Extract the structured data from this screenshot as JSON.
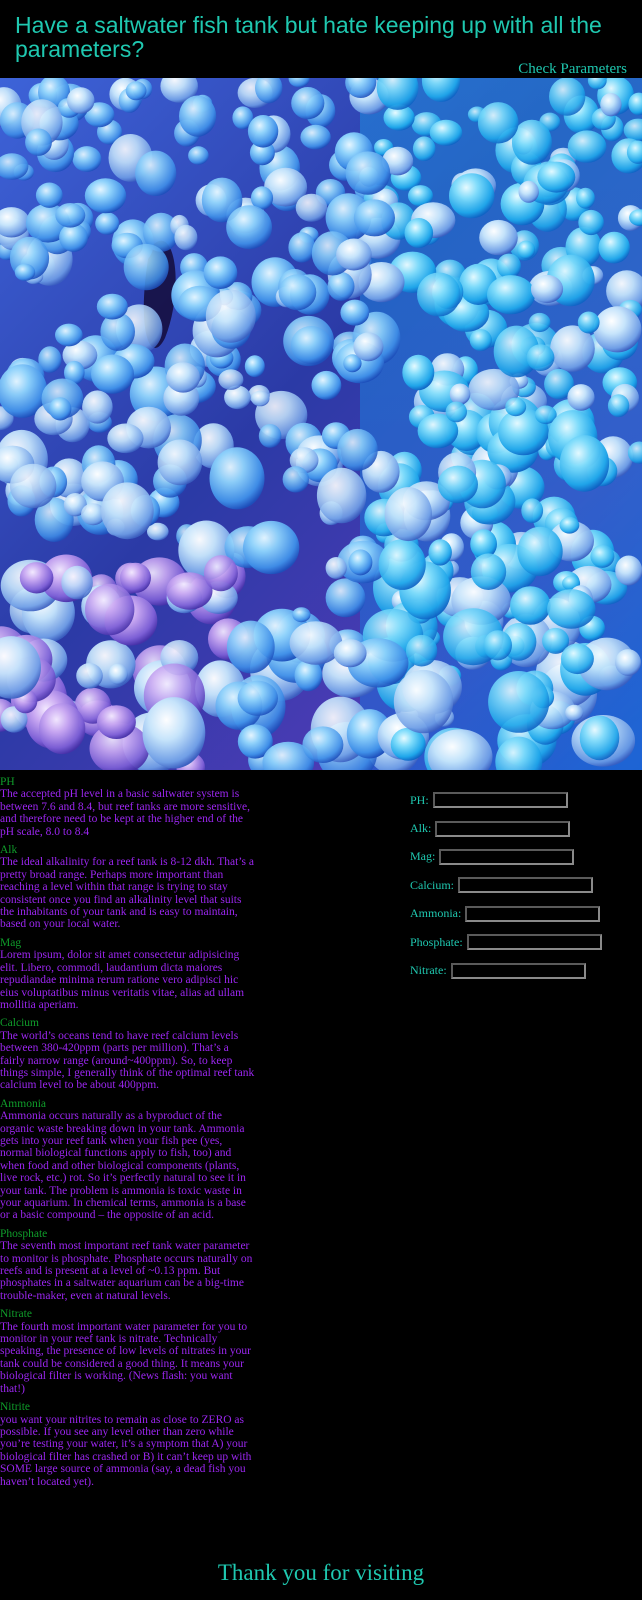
{
  "header": {
    "headline": "Have a saltwater fish tank but hate keeping up with all the parameters?",
    "check_link": "Check Parameters"
  },
  "hero": {
    "image": "bubble-coral-photo",
    "colors": {
      "deep": "#1a1f86",
      "mid": "#3c7fe6",
      "light": "#7fd0fb",
      "pink": "#c287e6"
    }
  },
  "parameters": [
    {
      "title": "PH",
      "text": "The accepted pH level in a basic saltwater system is between 7.6 and 8.4, but reef tanks are more sensitive, and therefore need to be kept at the higher end of the pH scale, 8.0 to 8.4"
    },
    {
      "title": "Alk",
      "text": "The ideal alkalinity for a reef tank is 8-12 dkh. That’s a pretty broad range. Perhaps more important than reaching a level within that range is trying to stay consistent once you find an alkalinity level that suits the inhabitants of your tank and is easy to maintain, based on your local water."
    },
    {
      "title": "Mag",
      "text": "Lorem ipsum, dolor sit amet consectetur adipisicing elit. Libero, commodi, laudantium dicta maiores repudiandae minima rerum ratione vero adipisci hic eius voluptatibus minus veritatis vitae, alias ad ullam mollitia aperiam."
    },
    {
      "title": "Calcium",
      "text": "The world’s oceans tend to have reef calcium levels between 380-420ppm (parts per million). That’s a fairly narrow range (around~400ppm). So, to keep things simple, I generally think of the optimal reef tank calcium level to be about 400ppm."
    },
    {
      "title": "Ammonia",
      "text": "Ammonia occurs naturally as a byproduct of the organic waste breaking down in your tank. Ammonia gets into your reef tank when your fish pee (yes, normal biological functions apply to fish, too) and when food and other biological components (plants, live rock, etc.) rot. So it’s perfectly natural to see it in your tank. The problem is ammonia is toxic waste in your aquarium. In chemical terms, ammonia is a base or a basic compound – the opposite of an acid."
    },
    {
      "title": "Phosphate",
      "text": "The seventh most important reef tank water parameter to monitor is phosphate. Phosphate occurs naturally on reefs and is present at a level of ~0.13 ppm. But phosphates in a saltwater aquarium can be a big-time trouble-maker, even at natural levels."
    },
    {
      "title": "Nitrate",
      "text": "The fourth most important water parameter for you to monitor in your reef tank is nitrate. Technically speaking, the presence of low levels of nitrates in your tank could be considered a good thing. It means your biological filter is working. (News flash: you want that!)"
    },
    {
      "title": "Nitrite",
      "text": "you want your nitrites to remain as close to ZERO as possible. If you see any level other than zero while you’re testing your water, it’s a symptom that A) your biological filter has crashed or B) it can’t keep up with SOME large source of ammonia (say, a dead fish you haven’t located yet)."
    }
  ],
  "form": {
    "fields": [
      {
        "label": "PH:",
        "value": ""
      },
      {
        "label": "Alk:",
        "value": ""
      },
      {
        "label": "Mag:",
        "value": ""
      },
      {
        "label": "Calcium:",
        "value": ""
      },
      {
        "label": "Ammonia:",
        "value": ""
      },
      {
        "label": "Phosphate:",
        "value": ""
      },
      {
        "label": "Nitrate:",
        "value": ""
      }
    ]
  },
  "footer": {
    "thanks": "Thank you for visiting"
  }
}
